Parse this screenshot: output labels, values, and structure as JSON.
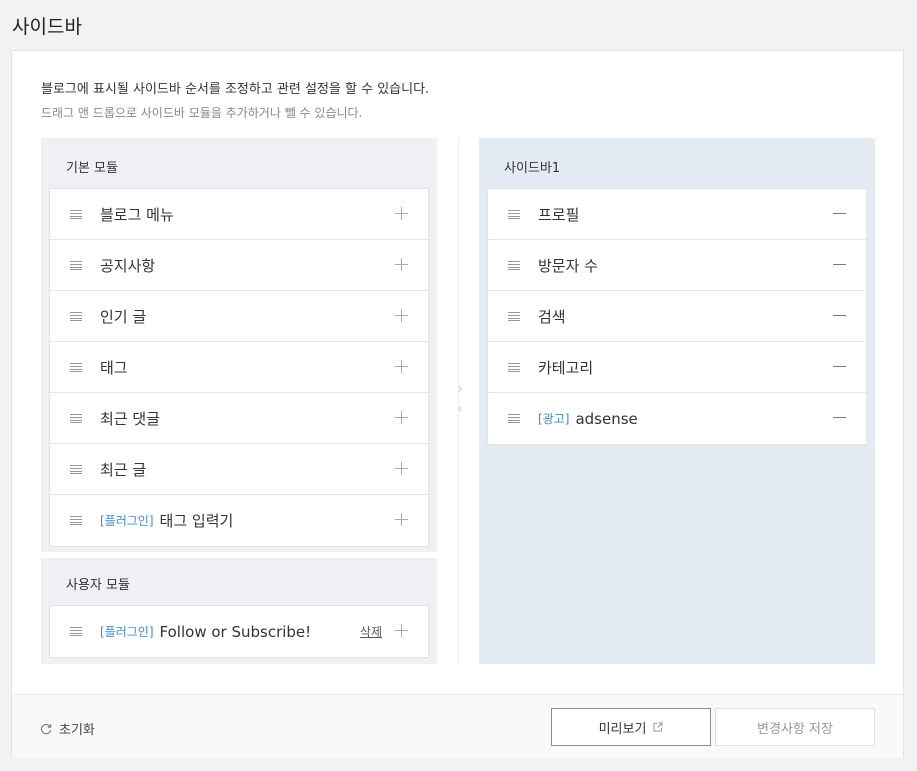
{
  "page": {
    "title": "사이드바"
  },
  "description": {
    "main": "블로그에 표시될 사이드바 순서를 조정하고 관련 설정을 할 수 있습니다.",
    "sub": "드래그 앤 드롭으로 사이드바 모듈을 추가하거나 뺄 수 있습니다."
  },
  "basic_modules": {
    "title": "기본 모듈",
    "items": [
      {
        "tag": "",
        "label": "블로그 메뉴"
      },
      {
        "tag": "",
        "label": "공지사항"
      },
      {
        "tag": "",
        "label": "인기 글"
      },
      {
        "tag": "",
        "label": "태그"
      },
      {
        "tag": "",
        "label": "최근 댓글"
      },
      {
        "tag": "",
        "label": "최근 글"
      },
      {
        "tag": "[플러그인]",
        "label": "태그 입력기"
      }
    ]
  },
  "user_modules": {
    "title": "사용자 모듈",
    "items": [
      {
        "tag": "[플러그인]",
        "label": "Follow or Subscribe!",
        "delete_label": "삭제"
      }
    ]
  },
  "sidebar1": {
    "title": "사이드바1",
    "items": [
      {
        "tag": "",
        "label": "프로필"
      },
      {
        "tag": "",
        "label": "방문자 수"
      },
      {
        "tag": "",
        "label": "검색"
      },
      {
        "tag": "",
        "label": "카테고리"
      },
      {
        "tag": "[광고]",
        "label": "adsense"
      }
    ]
  },
  "footer": {
    "reset_label": "초기화",
    "preview_label": "미리보기",
    "save_label": "변경사항 저장"
  },
  "icons": {
    "drag": "drag-handle-icon",
    "add": "plus-icon",
    "remove": "minus-icon",
    "reset": "refresh-icon",
    "external": "external-link-icon",
    "move_right": "chevron-right-icon",
    "move_left": "chevron-left-icon"
  },
  "colors": {
    "tag": "#3a8ecb",
    "sidebar_bg": "#e4ebf2",
    "module_bg": "#eff0f3"
  }
}
